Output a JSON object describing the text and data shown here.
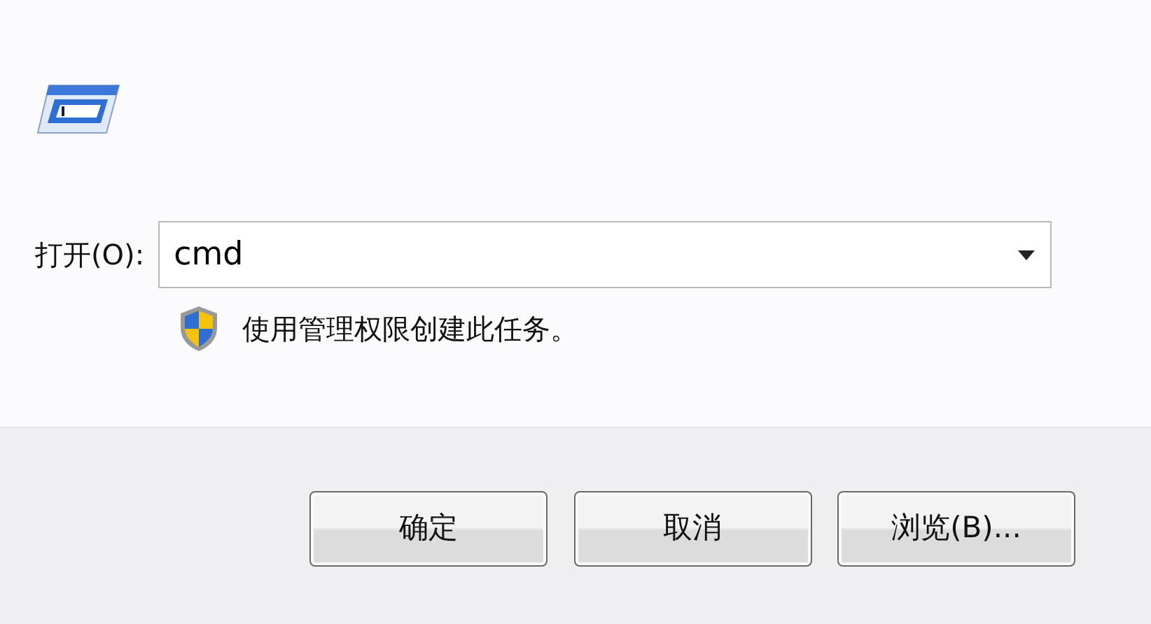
{
  "open_field": {
    "label": "打开(O):",
    "value": "cmd"
  },
  "admin_note": "使用管理权限创建此任务。",
  "buttons": [
    {
      "label": "确定"
    },
    {
      "label": "取消"
    },
    {
      "label": "浏览(B)..."
    }
  ]
}
